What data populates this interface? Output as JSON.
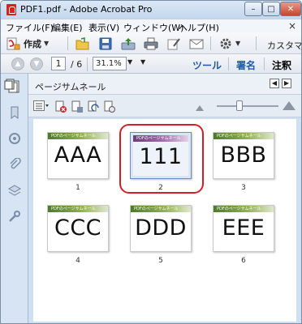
{
  "window": {
    "title": "PDF1.pdf - Adobe Acrobat Pro",
    "close_glyph": "✕",
    "min_glyph": "–",
    "max_glyph": "□"
  },
  "menu": {
    "items": [
      "ファイル(F)",
      "編集(E)",
      "表示(V)",
      "ウィンドウ(W)",
      "ヘルプ(H)"
    ],
    "close_glyph": "×"
  },
  "toolbar": {
    "create_label": "作成",
    "customize_label": "カスタマ"
  },
  "navigation": {
    "current_page": "1",
    "total_pages": "/ 6",
    "zoom": "31.1%"
  },
  "pane_tabs": [
    "ツール",
    "署名",
    "注釈"
  ],
  "pane_tabs_active": "注釈",
  "thumbnails_panel": {
    "title": "ページサムネール",
    "thumbnails": [
      {
        "text": "AAA",
        "number": "1",
        "banner": "PDFのページサムネール",
        "selected": false
      },
      {
        "text": "111",
        "number": "2",
        "banner": "PDFのページサムネール",
        "selected": true
      },
      {
        "text": "BBB",
        "number": "3",
        "banner": "PDFのページサムネール",
        "selected": false
      },
      {
        "text": "CCC",
        "number": "4",
        "banner": "PDFのページサムネール",
        "selected": false
      },
      {
        "text": "DDD",
        "number": "5",
        "banner": "PDFのページサムネール",
        "selected": false
      },
      {
        "text": "EEE",
        "number": "6",
        "banner": "PDFのページサムネール",
        "selected": false
      }
    ]
  },
  "colors": {
    "accent_blue": "#1e5aa8",
    "highlight_red": "#d21f28",
    "banner_green": "#4c7a2a",
    "banner_purple": "#6b3d7a"
  },
  "icons": {
    "app": "acrobat-icon",
    "create": "create-pdf-icon",
    "open": "open-folder-icon",
    "save": "save-icon",
    "upload": "upload-icon",
    "print": "print-icon",
    "email": "email-icon",
    "settings": "gear-icon"
  }
}
